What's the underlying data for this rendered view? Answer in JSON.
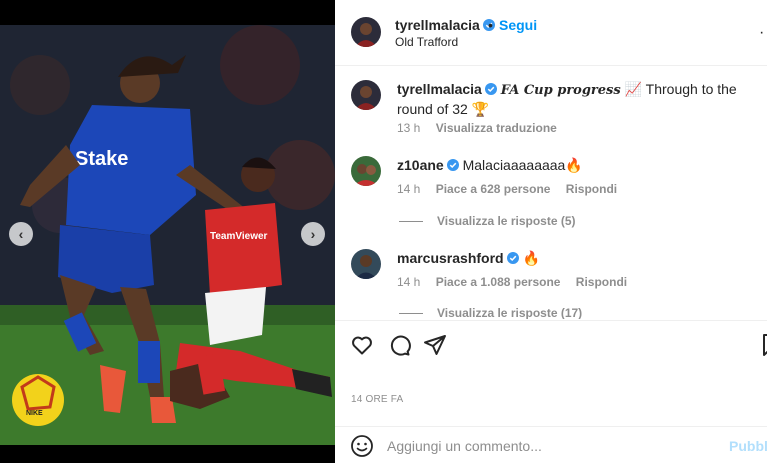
{
  "post": {
    "author": "tyrellmalacia",
    "follow_label": "Segui",
    "separator": "•",
    "location": "Old Trafford",
    "more_label": "···",
    "caption": {
      "user": "tyrellmalacia",
      "highlight": "FA Cup progress",
      "emoji_1": "📈",
      "text": "Through to the round of 32",
      "emoji_2": "🏆",
      "time": "13 h",
      "translate_label": "Visualizza traduzione"
    },
    "timestamp": "14 ORE FA"
  },
  "comments": [
    {
      "user": "z10ane",
      "text": "Malaciaaaaaaaa",
      "emoji": "🔥",
      "time": "14 h",
      "likes": "Piace a 628 persone",
      "reply_label": "Rispondi",
      "view_replies": "Visualizza le risposte (5)"
    },
    {
      "user": "marcusrashford",
      "text": "",
      "emoji": "🔥",
      "time": "14 h",
      "likes": "Piace a 1.088 persone",
      "reply_label": "Rispondi",
      "view_replies": "Visualizza le risposte (17)"
    }
  ],
  "composer": {
    "placeholder": "Aggiungi un commento...",
    "publish_label": "Pubblica"
  },
  "icons": {
    "like": "heart-icon",
    "comment": "comment-icon",
    "share": "paper-plane-icon",
    "save": "bookmark-icon",
    "emoji": "smiley-icon",
    "verified": "verified-badge-icon",
    "prev": "chevron-left-icon",
    "next": "chevron-right-icon"
  },
  "colors": {
    "accent": "#0095f6",
    "verified": "#3897f0",
    "muted": "#8e8e8e",
    "publish_disabled": "#b2dffc"
  }
}
